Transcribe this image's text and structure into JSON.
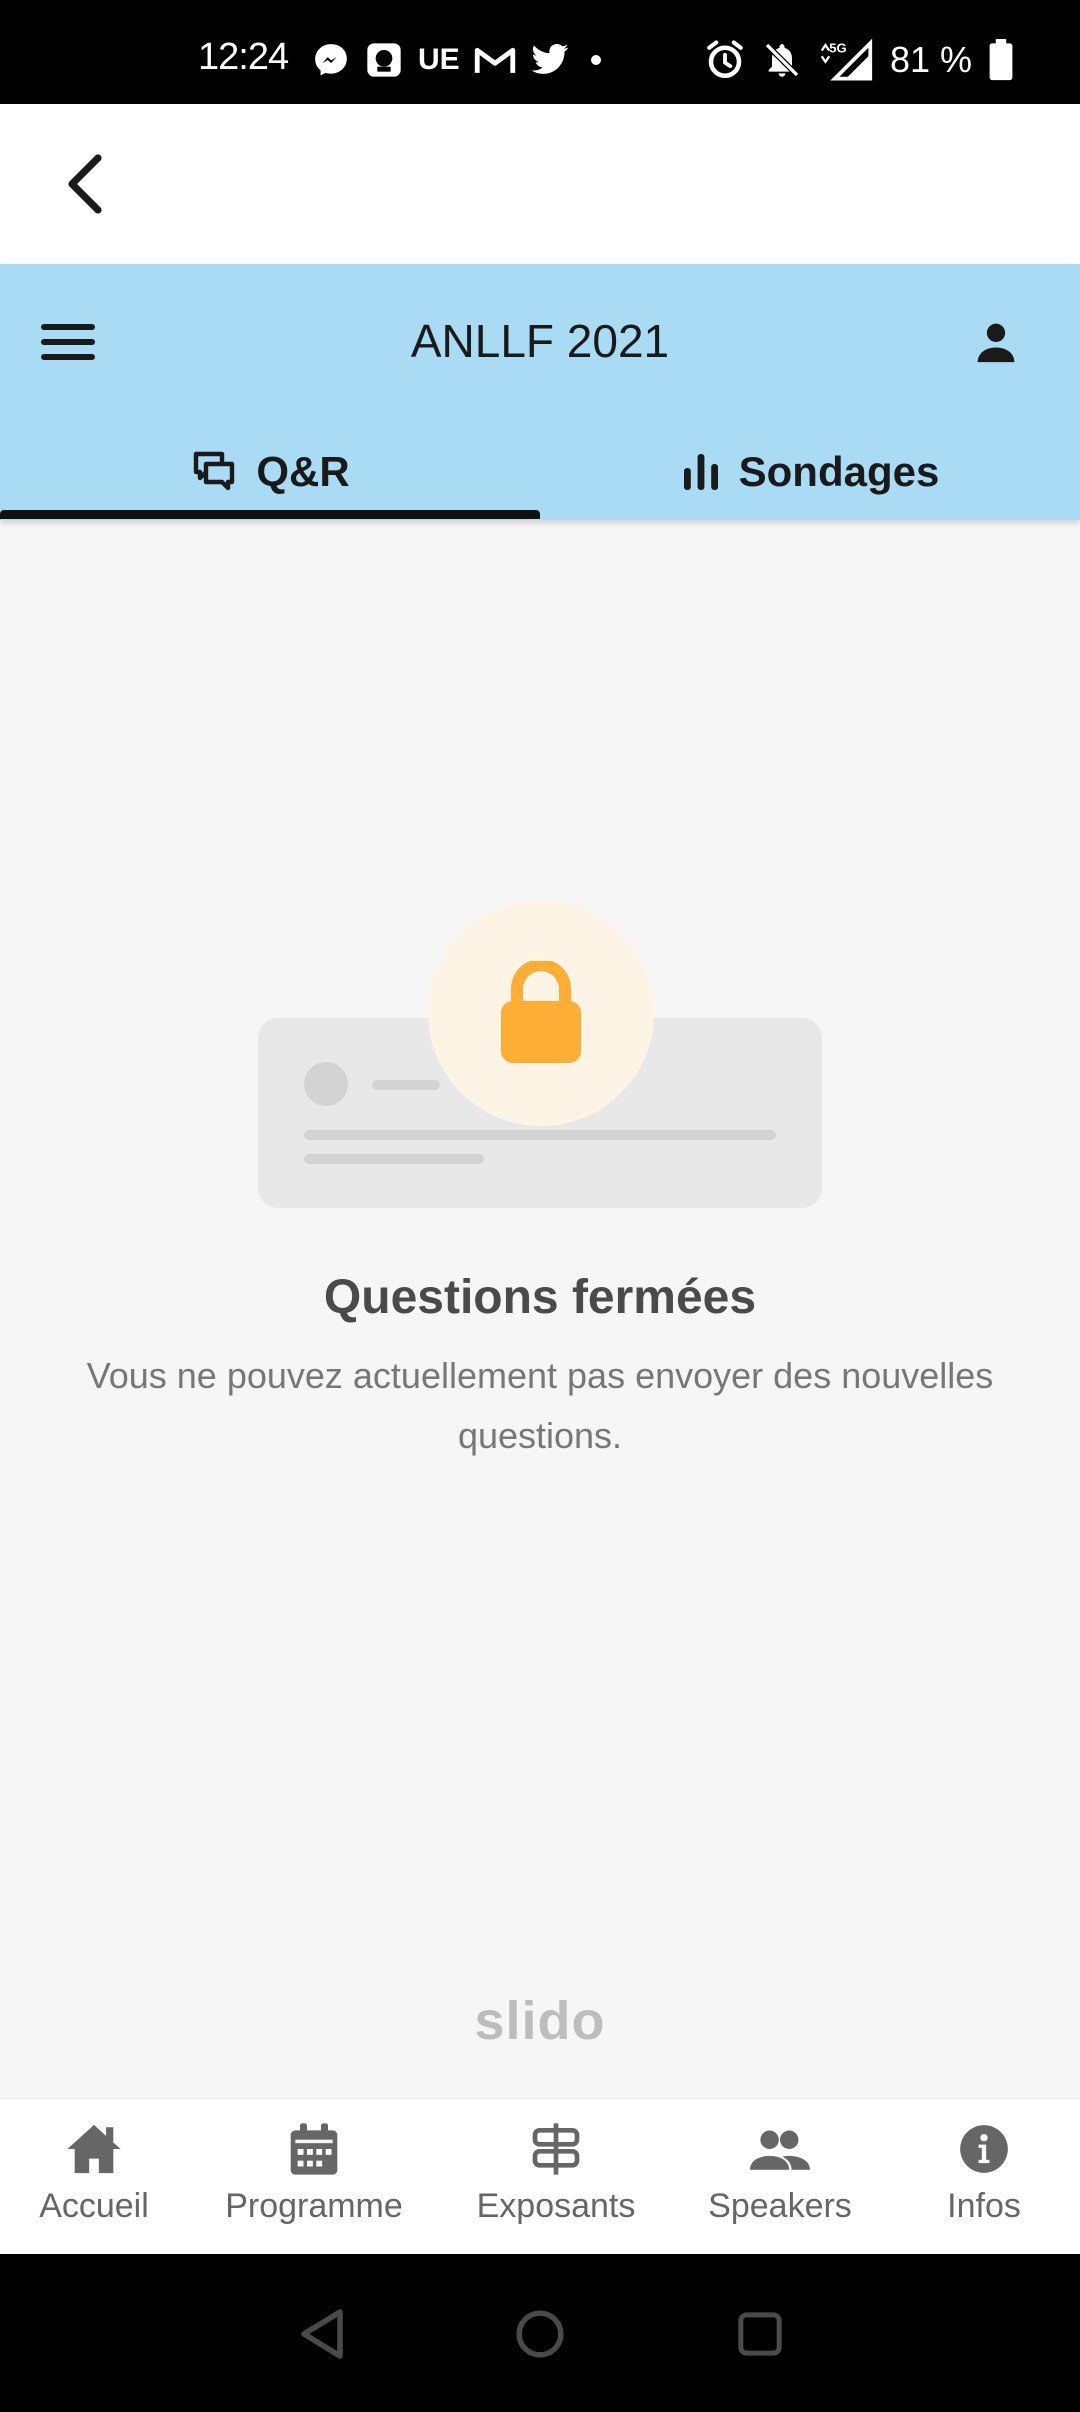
{
  "status_bar": {
    "time": "12:24",
    "carrier_badge": "UE",
    "network": "5G",
    "battery": "81 %"
  },
  "header": {
    "title": "ANLLF 2021",
    "tabs": [
      {
        "label": "Q&R",
        "icon": "chat-bubbles-icon",
        "active": true
      },
      {
        "label": "Sondages",
        "icon": "bar-chart-icon",
        "active": false
      }
    ]
  },
  "empty_state": {
    "title": "Questions fermées",
    "description": "Vous ne pouvez actuellement pas envoyer des nouvelles questions.",
    "icon": "lock-icon"
  },
  "branding": {
    "logo_text": "slido"
  },
  "bottom_nav": {
    "items": [
      {
        "label": "Accueil",
        "icon": "home-icon"
      },
      {
        "label": "Programme",
        "icon": "calendar-icon"
      },
      {
        "label": "Exposants",
        "icon": "signpost-icon"
      },
      {
        "label": "Speakers",
        "icon": "people-icon"
      },
      {
        "label": "Infos",
        "icon": "info-icon"
      }
    ]
  },
  "colors": {
    "header_bg": "#a9dbf5",
    "lock": "#ffae35",
    "lock_circle": "#fdf4e6",
    "tab_indicator": "#111111"
  }
}
